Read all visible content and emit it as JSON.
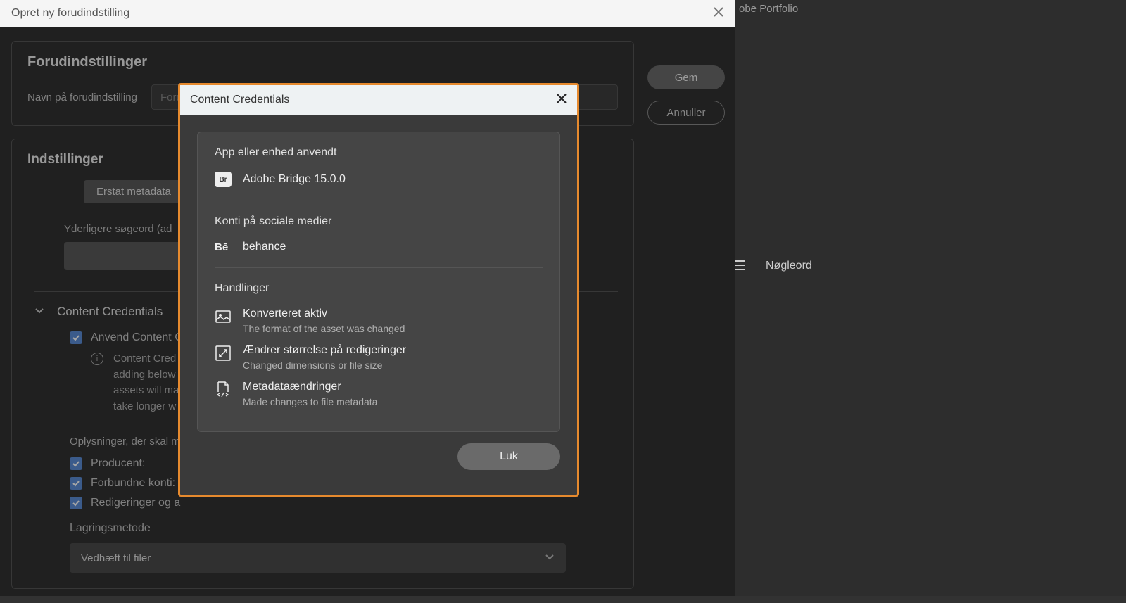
{
  "bg": {
    "portfolio": "obe Portfolio",
    "keywords": "Nøgleord"
  },
  "mainDialog": {
    "title": "Opret ny forudindstilling",
    "preset": {
      "heading": "Forudindstillinger",
      "label": "Navn på forudindstilling",
      "placeholder": "Forudindstilling"
    },
    "buttons": {
      "save": "Gem",
      "cancel": "Annuller"
    },
    "settings": {
      "heading": "Indstillinger",
      "replace": "Erstat metadata",
      "additionalKeywords": "Yderligere søgeord (ad",
      "cc_header": "Content Credentials",
      "cc_apply": "Anvend Content C",
      "cc_info_1": "Content Cred",
      "cc_info_2": "adding below",
      "cc_info_3": "assets will ma",
      "cc_info_4": "take longer w",
      "info_heading": "Oplysninger, der skal m",
      "cb_producer": "Producent:",
      "cb_accounts": "Forbundne konti: ",
      "cb_edits": "Redigeringer og a",
      "storage_label": "Lagringsmetode",
      "storage_value": "Vedhæft til filer"
    }
  },
  "innerModal": {
    "title": "Content Credentials",
    "app_heading": "App eller enhed anvendt",
    "app_name": "Adobe Bridge 15.0.0",
    "app_icon": "Br",
    "social_heading": "Konti på sociale medier",
    "social_name": "behance",
    "be_icon": "Bē",
    "actions_heading": "Handlinger",
    "actions": [
      {
        "title": "Konverteret aktiv",
        "desc": "The format of the asset was changed"
      },
      {
        "title": "Ændrer størrelse på redigeringer",
        "desc": "Changed dimensions or file size"
      },
      {
        "title": "Metadataændringer",
        "desc": "Made changes to file metadata"
      }
    ],
    "close": "Luk"
  }
}
